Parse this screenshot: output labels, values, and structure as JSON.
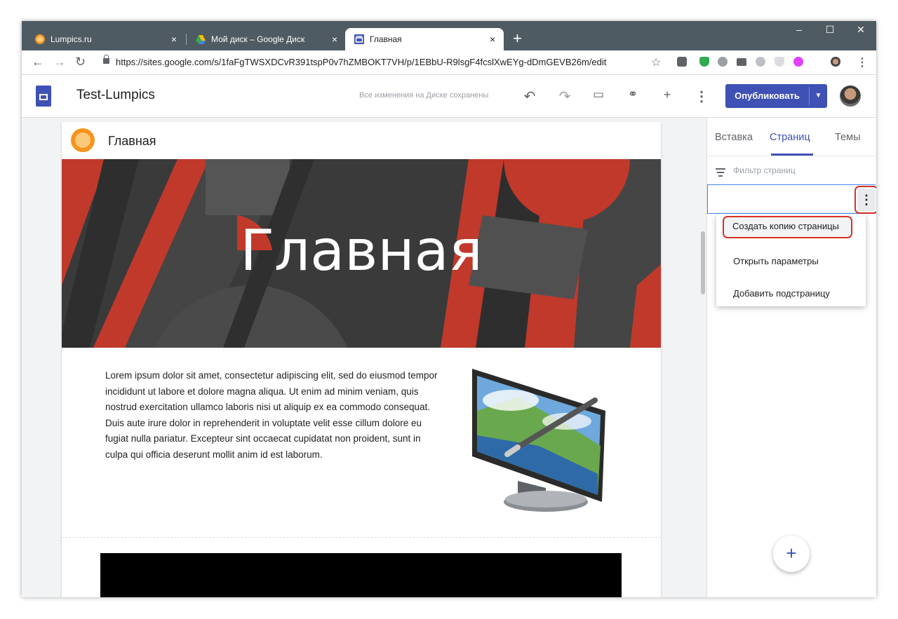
{
  "browser": {
    "tabs": [
      {
        "title": "Lumpics.ru",
        "close": "×"
      },
      {
        "title": "Мой диск – Google Диск",
        "close": "×"
      },
      {
        "title": "Главная",
        "close": "×"
      }
    ],
    "new_tab": "+",
    "window_controls": {
      "minimize": "–",
      "maximize": "☐",
      "close": "✕"
    },
    "url": "https://sites.google.com/s/1faFgTWSXDCvR391tspP0v7hZMBOKT7VH/p/1EBbU-R9lsgF4fcslXwEYg-dDmGEVB26m/edit"
  },
  "app": {
    "site_name": "Test-Lumpics",
    "save_status": "Все изменения на Диске сохранены",
    "publish_label": "Опубликовать"
  },
  "page": {
    "nav_title": "Главная",
    "hero_title": "Главная",
    "body_text": "Lorem ipsum dolor sit amet, consectetur adipiscing elit, sed do eiusmod tempor incididunt ut labore et dolore magna aliqua. Ut enim ad minim veniam, quis nostrud exercitation ullamco laboris nisi ut aliquip ex ea commodo consequat. Duis aute irure dolor in reprehenderit in voluptate velit esse cillum dolore eu fugiat nulla pariatur. Excepteur sint occaecat cupidatat non proident, sunt in culpa qui officia deserunt mollit anim id est laborum."
  },
  "panel": {
    "tabs": [
      "Вставка",
      "Страниц",
      "Темы"
    ],
    "active_tab": "Страниц",
    "filter_placeholder": "Фильтр страниц",
    "fab": "+"
  },
  "context_menu": {
    "items": [
      "Создать копию страницы",
      "Открыть параметры",
      "Добавить подстраницу"
    ]
  },
  "colors": {
    "accent": "#3f51b5",
    "highlight": "#d93025",
    "hero_red": "#c0392b"
  }
}
